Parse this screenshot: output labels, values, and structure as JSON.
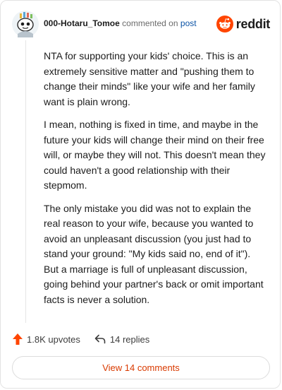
{
  "header": {
    "username": "000-Hotaru_Tomoe",
    "commented_text": "commented on",
    "post_link": "post",
    "brand": "reddit"
  },
  "comment": {
    "paragraphs": [
      "NTA for supporting your kids' choice. This is an extremely sensitive matter and \"pushing them to change their minds\" like your wife and her family want is plain wrong.",
      "I mean, nothing is fixed in time, and maybe in the future your kids will change their mind on their free will, or maybe they will not. This doesn't mean they could haven't a good relationship with their stepmom.",
      "The only mistake you did was not to explain the real reason to your wife, because you wanted to avoid an unpleasant discussion (you just had to stand your ground: \"My kids said no, end of it\"). But a marriage is full of unpleasant discussion, going behind your partner's back or omit important facts is never a solution."
    ]
  },
  "actions": {
    "upvotes": "1.8K upvotes",
    "replies": "14 replies",
    "view_comments": "View 14 comments"
  },
  "colors": {
    "accent": "#ff4500",
    "link": "#0a52a5",
    "view_button_text": "#d93a00"
  },
  "icons": {
    "avatar": "snoo-avatar-icon",
    "brand": "reddit-snoo-icon",
    "upvote": "upvote-arrow-icon",
    "reply": "reply-arrow-icon"
  }
}
